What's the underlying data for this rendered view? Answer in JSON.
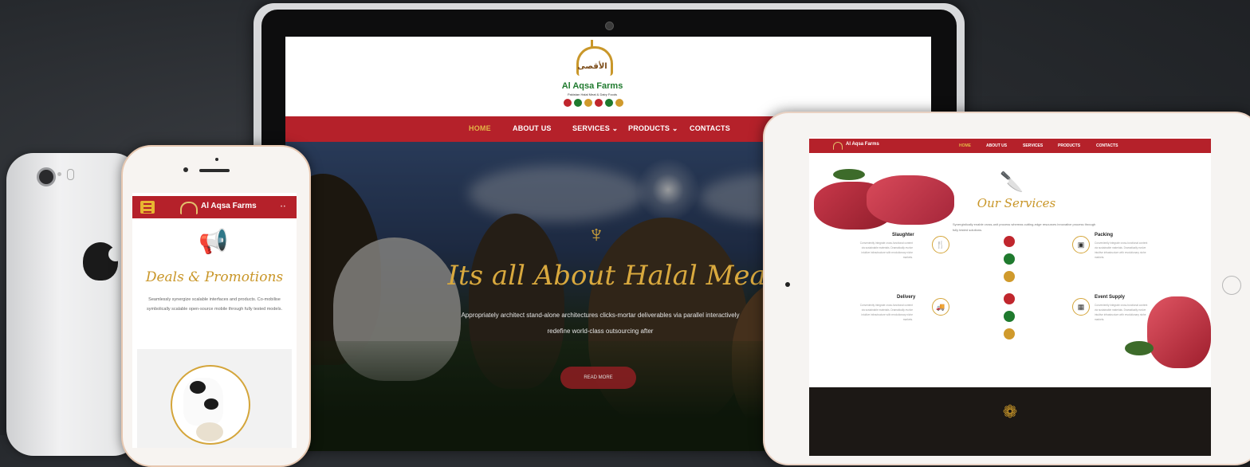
{
  "laptop": {
    "logo": {
      "arabic": "الأقصى",
      "name": "Al Aqsa Farms",
      "tagline": "Pakistan Halal Meat & Dairy Foods"
    },
    "nav": [
      "HOME",
      "ABOUT US",
      "SERVICES",
      "PRODUCTS",
      "CONTACTS"
    ],
    "hero": {
      "title": "Its all About Halal Meat",
      "text": "Appropriately architect stand-alone architectures clicks-mortar deliverables via parallel interactively redefine world-class outsourcing after",
      "button": "READ MORE"
    }
  },
  "phone": {
    "brand": "Al Aqsa Farms",
    "section_title": "Deals & Promotions",
    "text": "Seamlessly synergize scalable interfaces and products. Co-mobilise symbolically scalable open-source mobile through fully tested models."
  },
  "tablet": {
    "brand": "Al Aqsa Farms",
    "nav": [
      "HOME",
      "ABOUT US",
      "SERVICES",
      "PRODUCTS",
      "CONTACTS"
    ],
    "section_title": "Our Services",
    "section_text": "Synergistically enable cross-unit process whereas cutting-edge resources innovative process through fully tested solutions.",
    "services": [
      {
        "title": "Slaughter",
        "icon": "knife-icon"
      },
      {
        "title": "Packing",
        "icon": "box-icon"
      },
      {
        "title": "Delivery",
        "icon": "truck-icon"
      },
      {
        "title": "Event Supply",
        "icon": "calendar-icon"
      }
    ],
    "service_text": "Conveniently integrate cross-functional content via sustainable materials. Dramatically evolve intuitive infrastructure with revolutionary niche markets."
  },
  "colors": {
    "brand_red": "#b5212a",
    "gold": "#c99628",
    "green": "#1f7a2e"
  }
}
